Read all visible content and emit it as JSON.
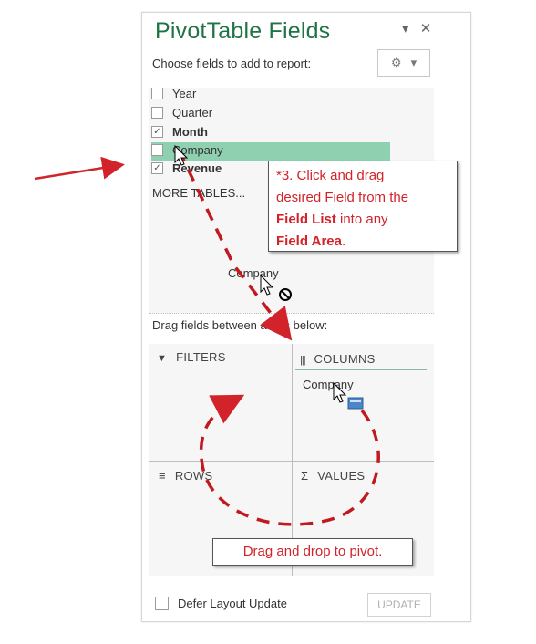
{
  "panel": {
    "title": "PivotTable Fields",
    "pin_glyph": "▾",
    "close_glyph": "✕",
    "choose_label": "Choose fields to add to report:",
    "gear_glyph": "⚙",
    "gear_caret": "▾"
  },
  "fields": [
    {
      "label": "Year",
      "checked": false,
      "bold": false
    },
    {
      "label": "Quarter",
      "checked": false,
      "bold": false
    },
    {
      "label": "Month",
      "checked": true,
      "bold": true
    },
    {
      "label": "Company",
      "checked": false,
      "bold": false
    },
    {
      "label": "Revenue",
      "checked": true,
      "bold": true
    }
  ],
  "more_tables": "MORE TABLES...",
  "drag_ghost_label": "Company",
  "drag_instruction": "Drag fields between areas below:",
  "areas": {
    "filters": {
      "icon": "filter-icon",
      "label": "FILTERS"
    },
    "columns": {
      "icon": "columns-icon",
      "label": "COLUMNS",
      "items": [
        "Company"
      ]
    },
    "rows": {
      "icon": "rows-icon",
      "label": "ROWS"
    },
    "values": {
      "icon": "sigma-icon",
      "label": "VALUES"
    }
  },
  "callout_field": {
    "line1": "*3. Click and drag",
    "line2": "desired Field from the",
    "line3_bold": "Field List",
    "line3_rest": " into any",
    "line4_bold": "Field Area",
    "line4_rest": "."
  },
  "callout_pivot": "Drag and drop to pivot.",
  "defer_label": "Defer Layout Update",
  "update_label": "UPDATE",
  "colors": {
    "title_green": "#217346",
    "drag_highlight": "#8ed0b0",
    "annotation_red": "#d2232a"
  }
}
